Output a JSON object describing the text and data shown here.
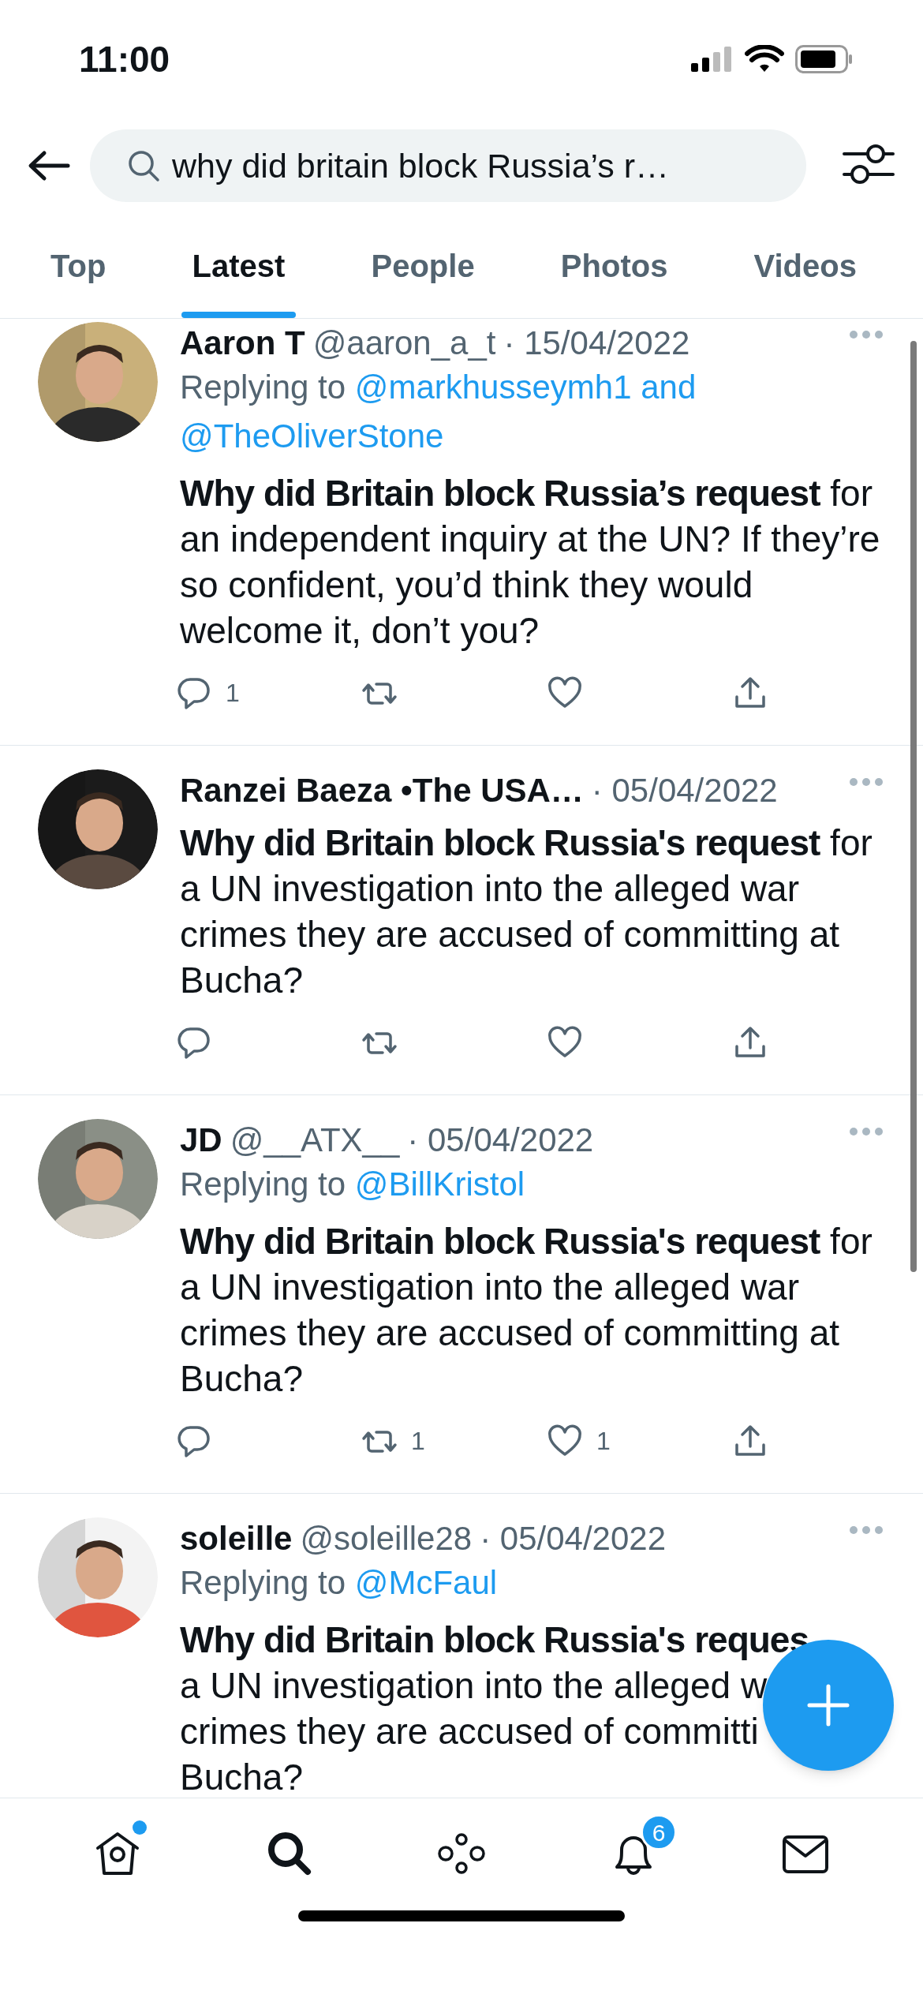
{
  "status_bar": {
    "time": "11:00"
  },
  "search": {
    "value": "why did britain block Russia’s r…"
  },
  "tabs": [
    {
      "label": "Top",
      "selected": false
    },
    {
      "label": "Latest",
      "selected": true
    },
    {
      "label": "People",
      "selected": false
    },
    {
      "label": "Photos",
      "selected": false
    },
    {
      "label": "Videos",
      "selected": false
    }
  ],
  "tweets": [
    {
      "name": "Aaron T",
      "handle": "@aaron_a_t",
      "date": "· 15/04/2022",
      "replying_to": {
        "label": "Replying to",
        "mentions": [
          "@markhusseymh1",
          "@TheOliverStone"
        ],
        "joiner": "and"
      },
      "text": "**Why did Britain block Russia’s request** for an independent inquiry at the UN? If they’re so confident, you’d think they would welcome it, don’t you?",
      "replies": "1"
    },
    {
      "name": "Ranzei Baeza •The USA…",
      "date": "· 05/04/2022",
      "text": "**Why did Britain block Russia's request** for a UN investigation into the alleged war crimes they are accused of committing at Bucha?"
    },
    {
      "name": "JD",
      "handle": "@__ATX__",
      "date": "· 05/04/2022",
      "replying_to": {
        "label": "Replying to",
        "mentions": [
          "@BillKristol"
        ]
      },
      "text": "**Why did Britain block Russia's request** for a UN investigation into the alleged war crimes they are accused of committing at Bucha?",
      "retweets": "1",
      "likes": "1"
    },
    {
      "name": "soleille",
      "handle": "@soleille28",
      "date": "· 05/04/2022",
      "replying_to": {
        "label": "Replying to",
        "mentions": [
          "@McFaul"
        ]
      },
      "text_lines": [
        "**Why did Britain block Russia's reques**",
        "a UN investigation into the alleged w",
        "crimes they are accused of committi",
        "Bucha?"
      ],
      "cut_off": true
    }
  ],
  "nav": {
    "home_unread": true,
    "notifications_badge": "6"
  }
}
